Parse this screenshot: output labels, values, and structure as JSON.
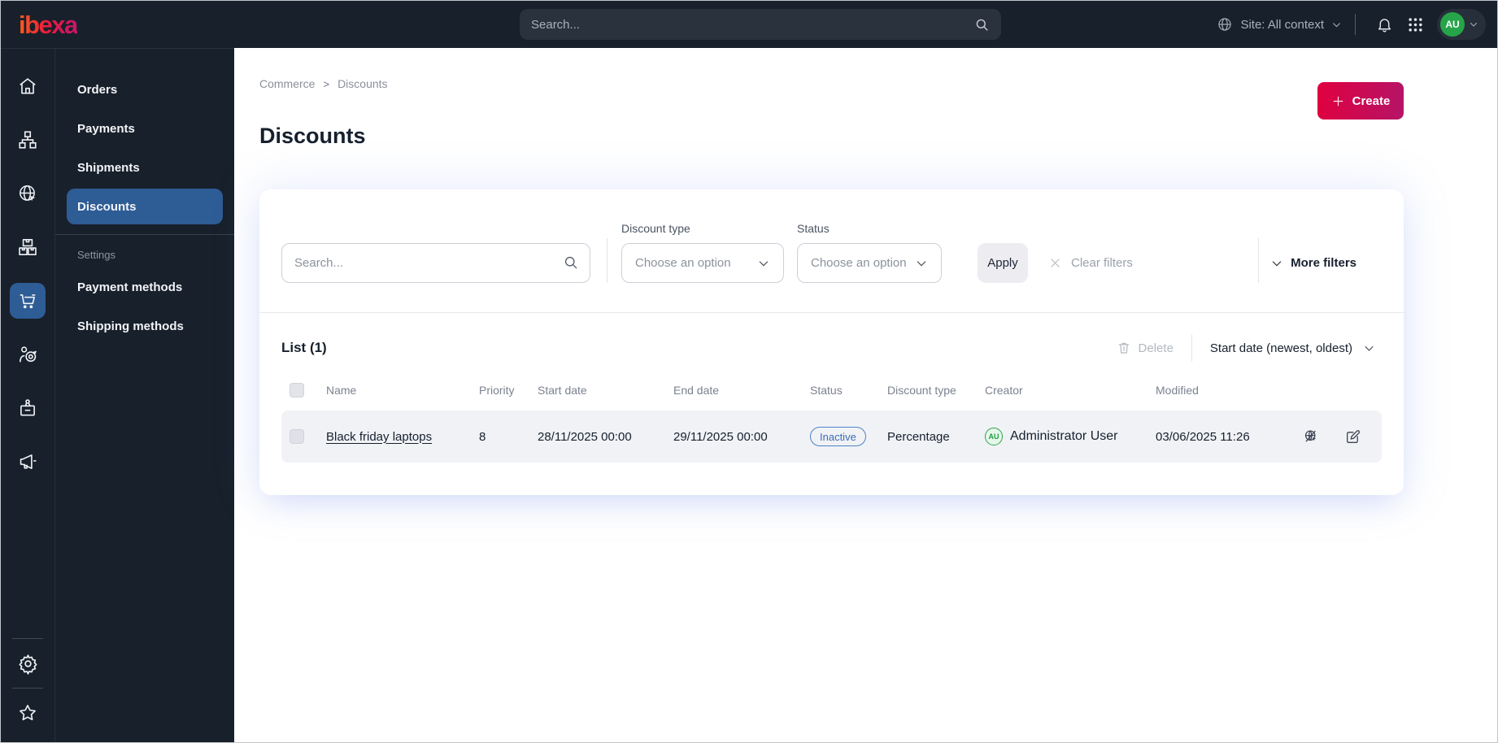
{
  "topbar": {
    "logo": "ibexa",
    "search_placeholder": "Search...",
    "site_context": "Site: All context",
    "avatar_initials": "AU"
  },
  "sidebar": {
    "icons": [
      "home",
      "content-structure",
      "site",
      "products",
      "commerce",
      "customers",
      "company",
      "marketing",
      "settings",
      "bookmarks"
    ]
  },
  "menu": {
    "items": [
      {
        "label": "Orders"
      },
      {
        "label": "Payments"
      },
      {
        "label": "Shipments"
      },
      {
        "label": "Discounts",
        "active": true
      }
    ],
    "settings_label": "Settings",
    "settings_items": [
      {
        "label": "Payment methods"
      },
      {
        "label": "Shipping methods"
      }
    ]
  },
  "page": {
    "breadcrumb": [
      "Commerce",
      "Discounts"
    ],
    "breadcrumb_separator": ">",
    "title": "Discounts",
    "create_label": "Create"
  },
  "filters": {
    "search_placeholder": "Search...",
    "discount_type_label": "Discount type",
    "discount_type_value": "Choose an option",
    "status_label": "Status",
    "status_value": "Choose an option",
    "apply_label": "Apply",
    "clear_label": "Clear filters",
    "more_label": "More filters"
  },
  "list": {
    "title": "List (1)",
    "delete_label": "Delete",
    "sort_label": "Start date (newest, oldest)",
    "columns": [
      "Name",
      "Priority",
      "Start date",
      "End date",
      "Status",
      "Discount type",
      "Creator",
      "Modified"
    ],
    "rows": [
      {
        "name": "Black friday laptops",
        "priority": "8",
        "start_date": "28/11/2025 00:00",
        "end_date": "29/11/2025 00:00",
        "status": "Inactive",
        "discount_type": "Percentage",
        "creator_initials": "AU",
        "creator_name": "Administrator User",
        "modified": "03/06/2025 11:26"
      }
    ]
  },
  "colors": {
    "topbar_bg": "#18202b",
    "active_blue": "#2e5c95",
    "create_gradient_start": "#e0003f",
    "create_gradient_end": "#b51467",
    "status_badge_blue": "#3a6db6",
    "avatar_green": "#26a449"
  }
}
